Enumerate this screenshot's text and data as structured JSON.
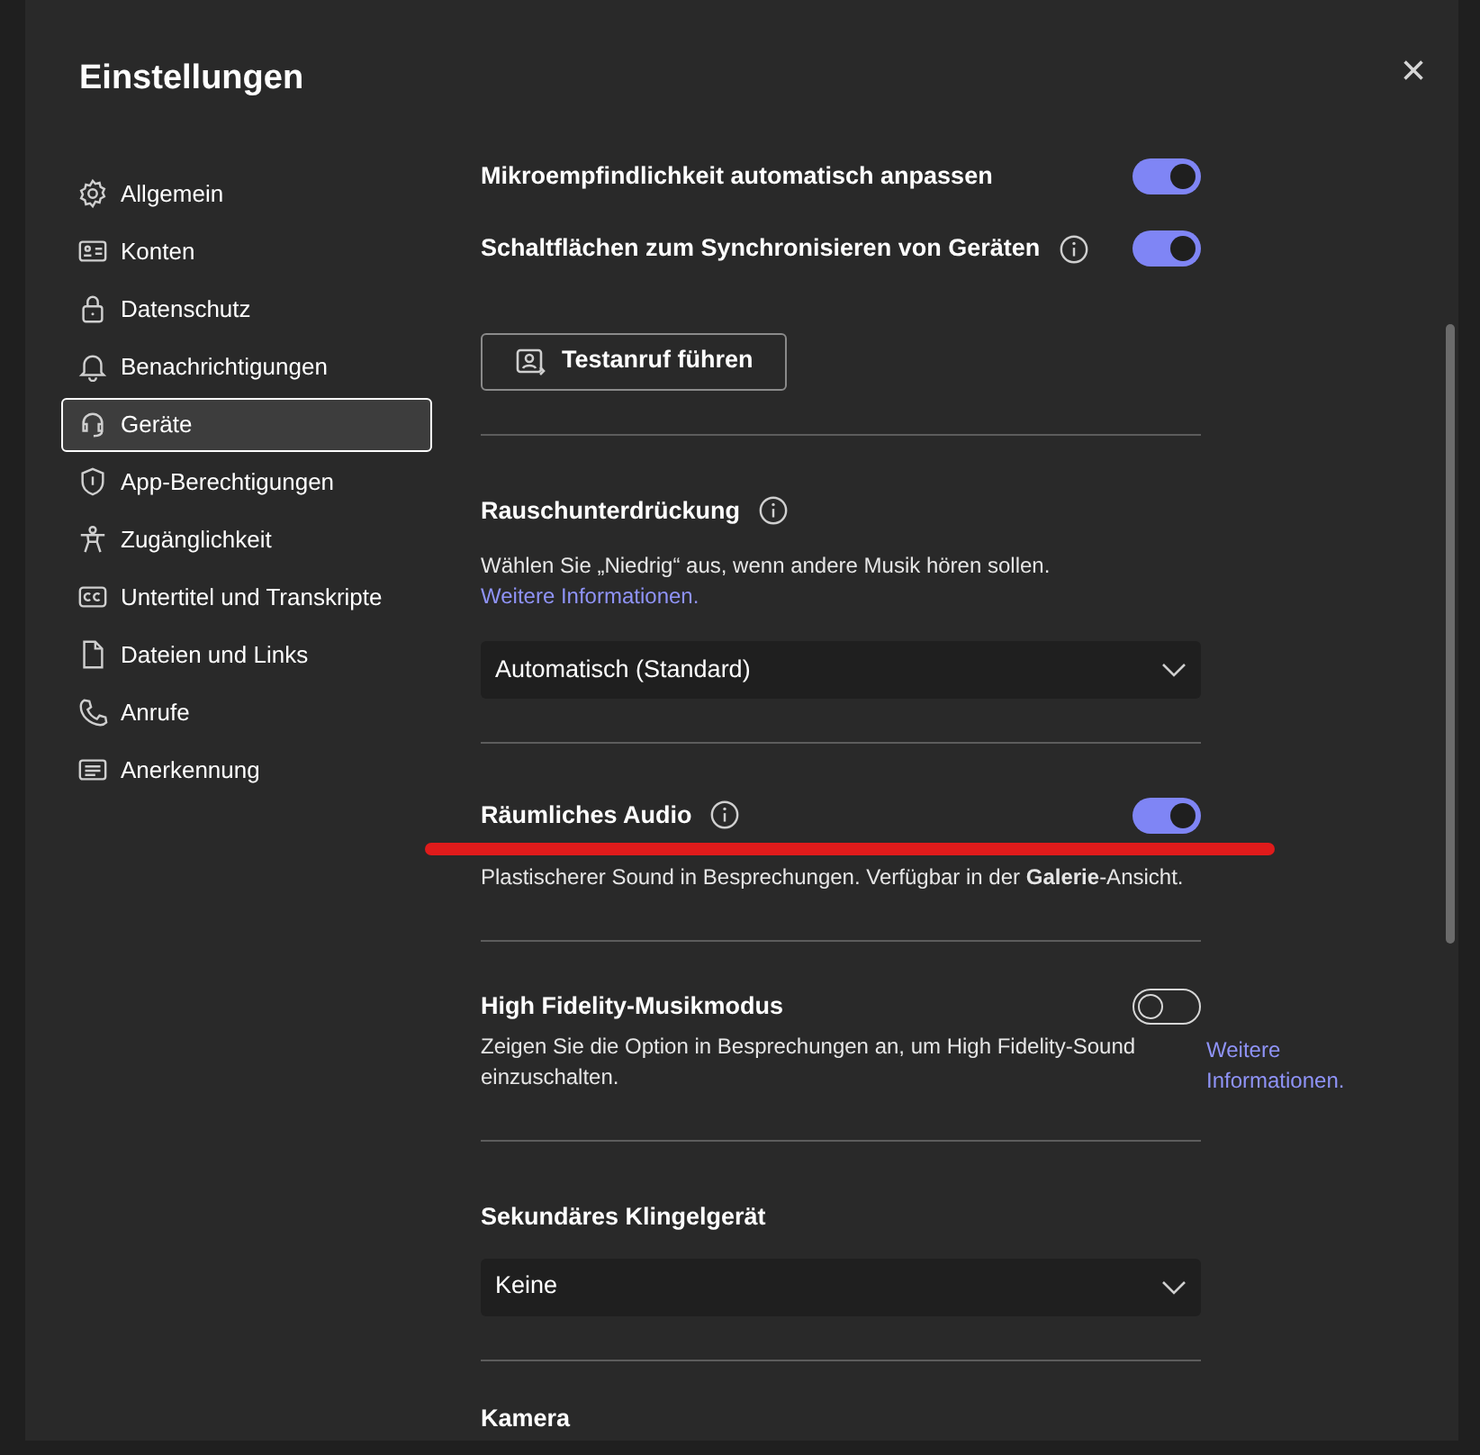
{
  "dialog": {
    "title": "Einstellungen",
    "close": "×"
  },
  "sidebar": {
    "items": [
      {
        "label": "Allgemein",
        "selected": false
      },
      {
        "label": "Konten",
        "selected": false
      },
      {
        "label": "Datenschutz",
        "selected": false
      },
      {
        "label": "Benachrichtigungen",
        "selected": false
      },
      {
        "label": "Geräte",
        "selected": true
      },
      {
        "label": "App-Berechtigungen",
        "selected": false
      },
      {
        "label": "Zugänglichkeit",
        "selected": false
      },
      {
        "label": "Untertitel und Transkripte",
        "selected": false
      },
      {
        "label": "Dateien und Links",
        "selected": false
      },
      {
        "label": "Anrufe",
        "selected": false
      },
      {
        "label": "Anerkennung",
        "selected": false
      }
    ]
  },
  "sections": [
    {
      "kind": "toggle",
      "title": "Mikroempfindlichkeit automatisch anpassen",
      "on": true
    },
    {
      "kind": "toggle",
      "title": "Schaltflächen zum Synchronisieren von Geräten",
      "info": true,
      "on": true
    },
    {
      "kind": "button",
      "label": "Testanruf führen"
    },
    {
      "kind": "divider"
    },
    {
      "kind": "select",
      "title": "Rauschunterdrückung",
      "info": true,
      "description": "Wählen Sie „Niedrig“ aus, wenn andere Musik hören sollen.",
      "link": "Weitere Informationen.",
      "value": "Automatisch (Standard)"
    },
    {
      "kind": "divider"
    },
    {
      "kind": "toggle",
      "title": "Räumliches Audio",
      "info": true,
      "on": true,
      "annotated": true,
      "description": "Plastischerer Sound in Besprechungen. Verfügbar in der **Galerie**-Ansicht."
    },
    {
      "kind": "divider"
    },
    {
      "kind": "toggle",
      "title": "High Fidelity-Musikmodus",
      "on": false,
      "description": "Zeigen Sie die Option in Besprechungen an, um High Fidelity-Sound einzuschalten.",
      "side_link": "Weitere Informationen."
    },
    {
      "kind": "divider"
    },
    {
      "kind": "select",
      "title": "Sekundäres Klingelgerät",
      "value": "Keine"
    },
    {
      "kind": "divider"
    },
    {
      "kind": "heading",
      "title": "Kamera"
    }
  ]
}
